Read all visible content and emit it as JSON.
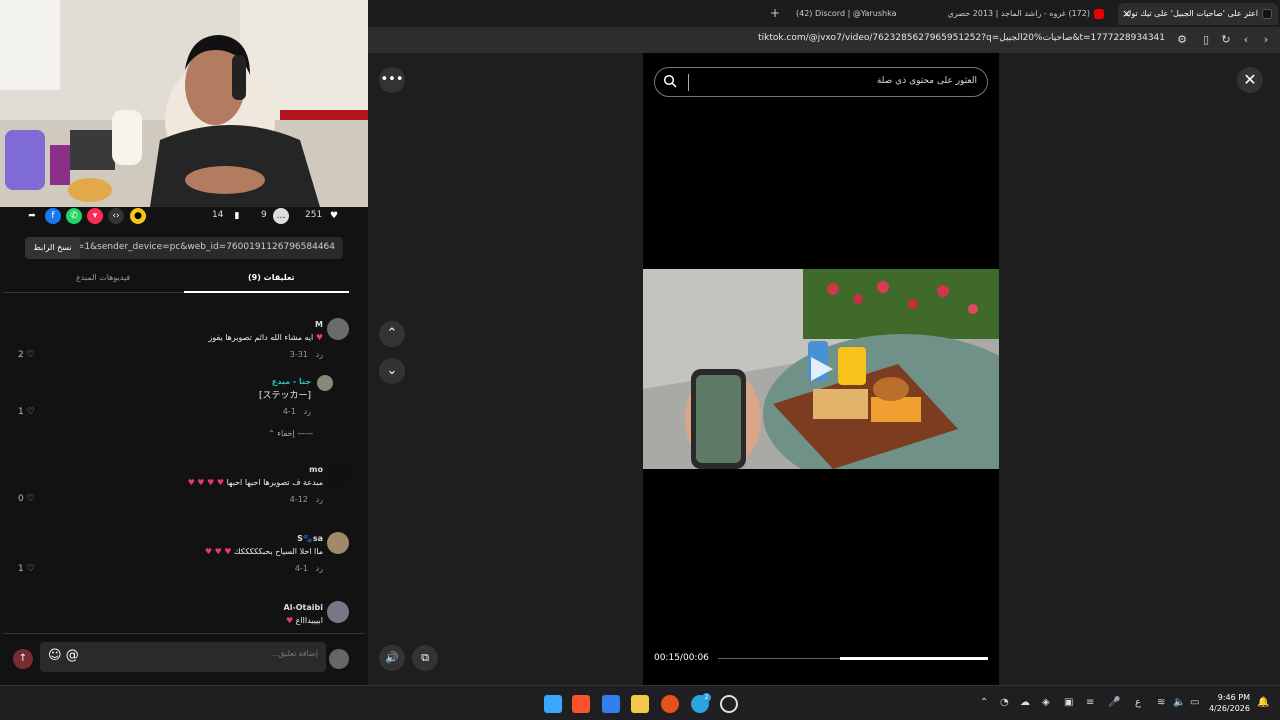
{
  "browser": {
    "tabs": [
      {
        "label": "اعثر على 'صاحيات الجبيل' على تيك توك",
        "active": true
      },
      {
        "label": "(172) غروه - راشد الماجد | 2013 حصري",
        "active": false
      },
      {
        "label": "(42) Discord | @Yarushka",
        "active": false
      }
    ],
    "new_tab_label": "+",
    "close_tab": "×",
    "url": "tiktok.com/@jvxo7/video/7623285627965951252?q=صاحيات%20الجبيل&t=1777228934341"
  },
  "actions": {
    "likes": "251",
    "comments": "9",
    "bookmarks": "14"
  },
  "share": {
    "link_text": "...p=1&sender_device=pc&web_id=7600191126796584464",
    "copy_label": "نسخ الرابط"
  },
  "panel_tabs": {
    "comments": "تعليقات (9)",
    "creator_videos": "فيديوهات المبدع"
  },
  "comments": [
    {
      "user": "M",
      "text": "ايه مشاء الله دائم تصويرها يفوز",
      "date": "3-31",
      "reply": "رد",
      "likes": "2"
    },
    {
      "user": "جنا - مبدع",
      "text": "[ステッカー]",
      "date": "4-1",
      "reply": "رد",
      "likes": "1",
      "nested": true
    },
    {
      "user": "mo",
      "text": "مبدعة ف تصويرها احبها احبها",
      "date": "4-12",
      "reply": "رد",
      "likes": "0"
    },
    {
      "user": "S🐾sa",
      "text": "ماا احلا السياح بحبكككككك",
      "date": "4-1",
      "reply": "رد",
      "likes": "1"
    },
    {
      "user": "Al-Otaibi",
      "text": "ابيييداااع",
      "date": "",
      "reply": "",
      "likes": ""
    }
  ],
  "hide_label": "إخفاء",
  "comment_input": {
    "placeholder": "إضافة تعليق..."
  },
  "viewer": {
    "search_placeholder": "العثور على محتوى ذي صلة",
    "timecode": "00:15/00:06",
    "progress": 0.45
  },
  "clock": {
    "time": "9:46 PM",
    "date": "4/26/2026"
  },
  "tray": {
    "lang": "ع",
    "badge": "2"
  },
  "colors": {
    "accent": "#fe2c55",
    "bg": "#121212"
  }
}
